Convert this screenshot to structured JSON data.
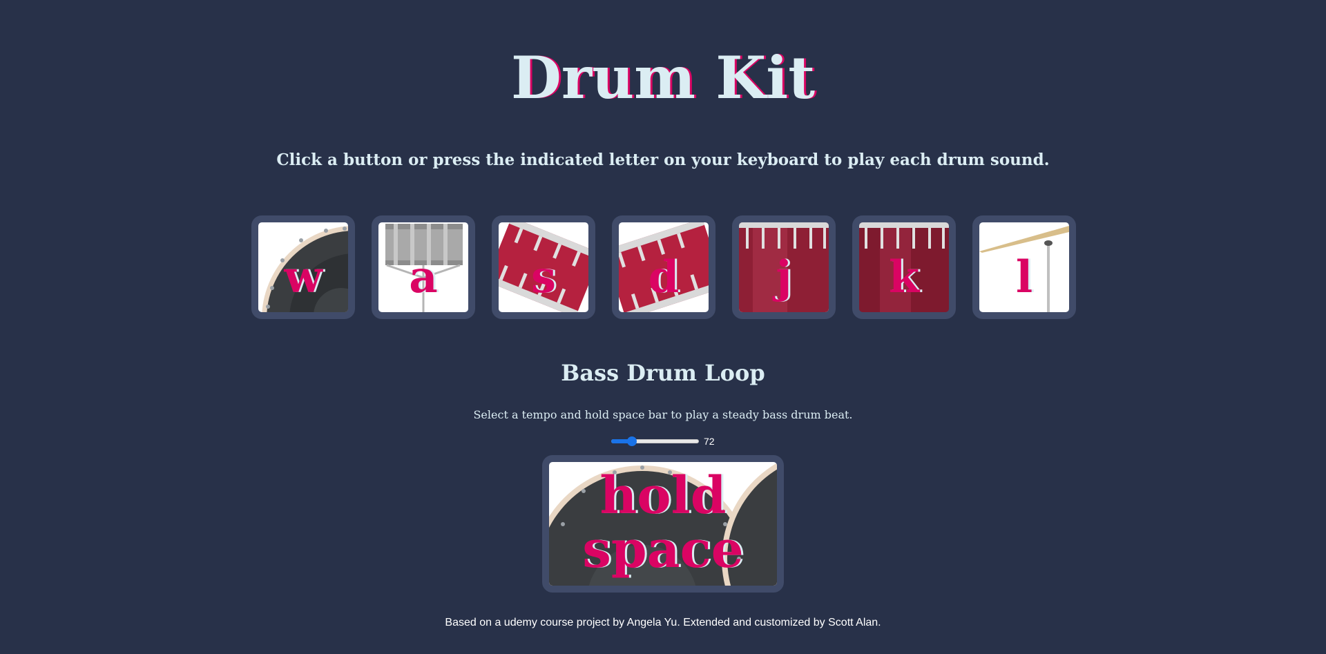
{
  "page": {
    "title": "Drum Kit",
    "subtitle": "Click a button or press the indicated letter on your keyboard to play each drum sound."
  },
  "drums": [
    {
      "key": "w",
      "name": "bass-drum-icon"
    },
    {
      "key": "a",
      "name": "snare-stand-icon"
    },
    {
      "key": "s",
      "name": "tom-drum-icon"
    },
    {
      "key": "d",
      "name": "tom-drum-icon"
    },
    {
      "key": "j",
      "name": "floor-tom-icon"
    },
    {
      "key": "k",
      "name": "floor-tom-icon"
    },
    {
      "key": "l",
      "name": "cymbal-icon"
    }
  ],
  "loop": {
    "title": "Bass Drum Loop",
    "description": "Select a tempo and hold space bar to play a steady bass drum beat.",
    "tempo_value": "72",
    "tempo_level": 0.24,
    "hold_label_line1": "hold",
    "hold_label_line2": "space"
  },
  "footer": {
    "text": "Based on a udemy course project by Angela Yu. Extended and customized by Scott Alan."
  },
  "colors": {
    "background": "#283149",
    "button_frame": "#404B69",
    "accent": "#DA0463",
    "text": "#DBEDF3",
    "slider": "#1A73E8"
  }
}
